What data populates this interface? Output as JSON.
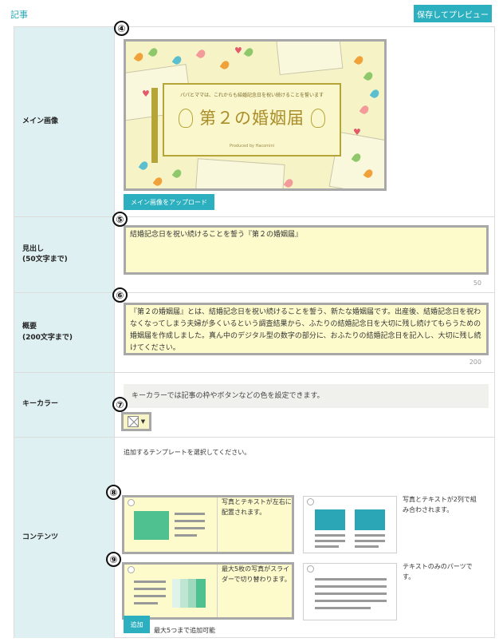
{
  "header": {
    "section_title": "記事",
    "preview_button": "保存してプレビュー"
  },
  "fields": {
    "main_image": {
      "label": "メイン画像",
      "marker": "④",
      "image": {
        "subtitle": "パパとママは、これからも結婚記念日を祝い続けることを誓います",
        "title": "第２の婚姻届",
        "credit": "Produced by Hacomini"
      },
      "upload_button": "メイン画像をアップロード"
    },
    "headline": {
      "label": "見出し\n(50文字まで)",
      "marker": "⑤",
      "value": "結婚記念日を祝い続けることを誓う『第２の婚姻届』",
      "counter": "50"
    },
    "summary": {
      "label": "概要\n(200文字まで)",
      "marker": "⑥",
      "value": "『第２の婚姻届』とは、結婚記念日を祝い続けることを誓う、新たな婚姻届です。出産後、結婚記念日を祝わなくなってしまう夫婦が多くいるという調査結果から、ふたりの結婚記念日を大切に残し続けてもらうための婚姻届を作成しました。真ん中のデジタル型の数字の部分に、おふたりの結婚記念日を記入し、大切に残し続けてください。",
      "counter": "200"
    },
    "key_color": {
      "label": "キーカラー",
      "marker": "⑦",
      "note": "キーカラーでは記事の枠やボタンなどの色を設定できます。",
      "arrow": "▼"
    },
    "contents": {
      "label": "コンテンツ",
      "instruction": "追加するテンプレートを選択してください。",
      "templates": [
        {
          "marker": "⑧",
          "desc": "写真とテキストが左右に配置されます。"
        },
        {
          "desc": "写真とテキストが2列で組み合わされます。"
        },
        {
          "marker": "⑨",
          "desc": "最大5枚の写真がスライダーで切り替わります。"
        },
        {
          "desc": "テキストのみのパーツです。"
        }
      ],
      "add_button": "追加",
      "add_note": "最大5つまで追加可能"
    }
  },
  "colors": {
    "accent": "#2cb0bf",
    "label_bg": "#dff0f3",
    "highlight": "#fdfbcc",
    "template_green": "#4fc191",
    "template_teal": "#2aa6b6"
  }
}
